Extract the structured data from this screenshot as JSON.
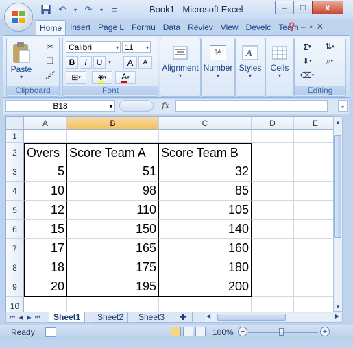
{
  "window": {
    "title": "Book1 - Microsoft Excel",
    "controls": {
      "minimize": "–",
      "restore": "□",
      "close": "x"
    }
  },
  "ribbon_tabs": [
    "Home",
    "Insert",
    "Page L",
    "Formu",
    "Data",
    "Reviev",
    "View",
    "Develc",
    "Team"
  ],
  "ribbon": {
    "clipboard": {
      "label": "Clipboard",
      "paste": "Paste"
    },
    "font": {
      "label": "Font",
      "family": "Calibri",
      "size": "11",
      "bold": "B",
      "italic": "I",
      "underline": "U",
      "grow": "A",
      "shrink": "A",
      "fontcolor": "A"
    },
    "alignment": {
      "label": "Alignment"
    },
    "number": {
      "label": "Number",
      "symbol": "%"
    },
    "styles": {
      "label": "Styles"
    },
    "cells": {
      "label": "Cells"
    },
    "editing": {
      "label": "Editing",
      "sum": "Σ"
    }
  },
  "formula_bar": {
    "name_box": "B18",
    "fx": "fx",
    "formula": ""
  },
  "columns": [
    "A",
    "B",
    "C",
    "D",
    "E"
  ],
  "rows": [
    "1",
    "2",
    "3",
    "4",
    "5",
    "6",
    "7",
    "8",
    "9",
    "10"
  ],
  "table": {
    "headers": [
      "Overs",
      "Score Team A",
      "Score Team B"
    ],
    "rows": [
      [
        "5",
        "51",
        "32"
      ],
      [
        "10",
        "98",
        "85"
      ],
      [
        "12",
        "110",
        "105"
      ],
      [
        "15",
        "150",
        "140"
      ],
      [
        "17",
        "165",
        "160"
      ],
      [
        "18",
        "175",
        "180"
      ],
      [
        "20",
        "195",
        "200"
      ]
    ]
  },
  "sheet_tabs": [
    "Sheet1",
    "Sheet2",
    "Sheet3"
  ],
  "status": {
    "text": "Ready",
    "zoom": "100%",
    "zoom_level_percent": 100
  }
}
